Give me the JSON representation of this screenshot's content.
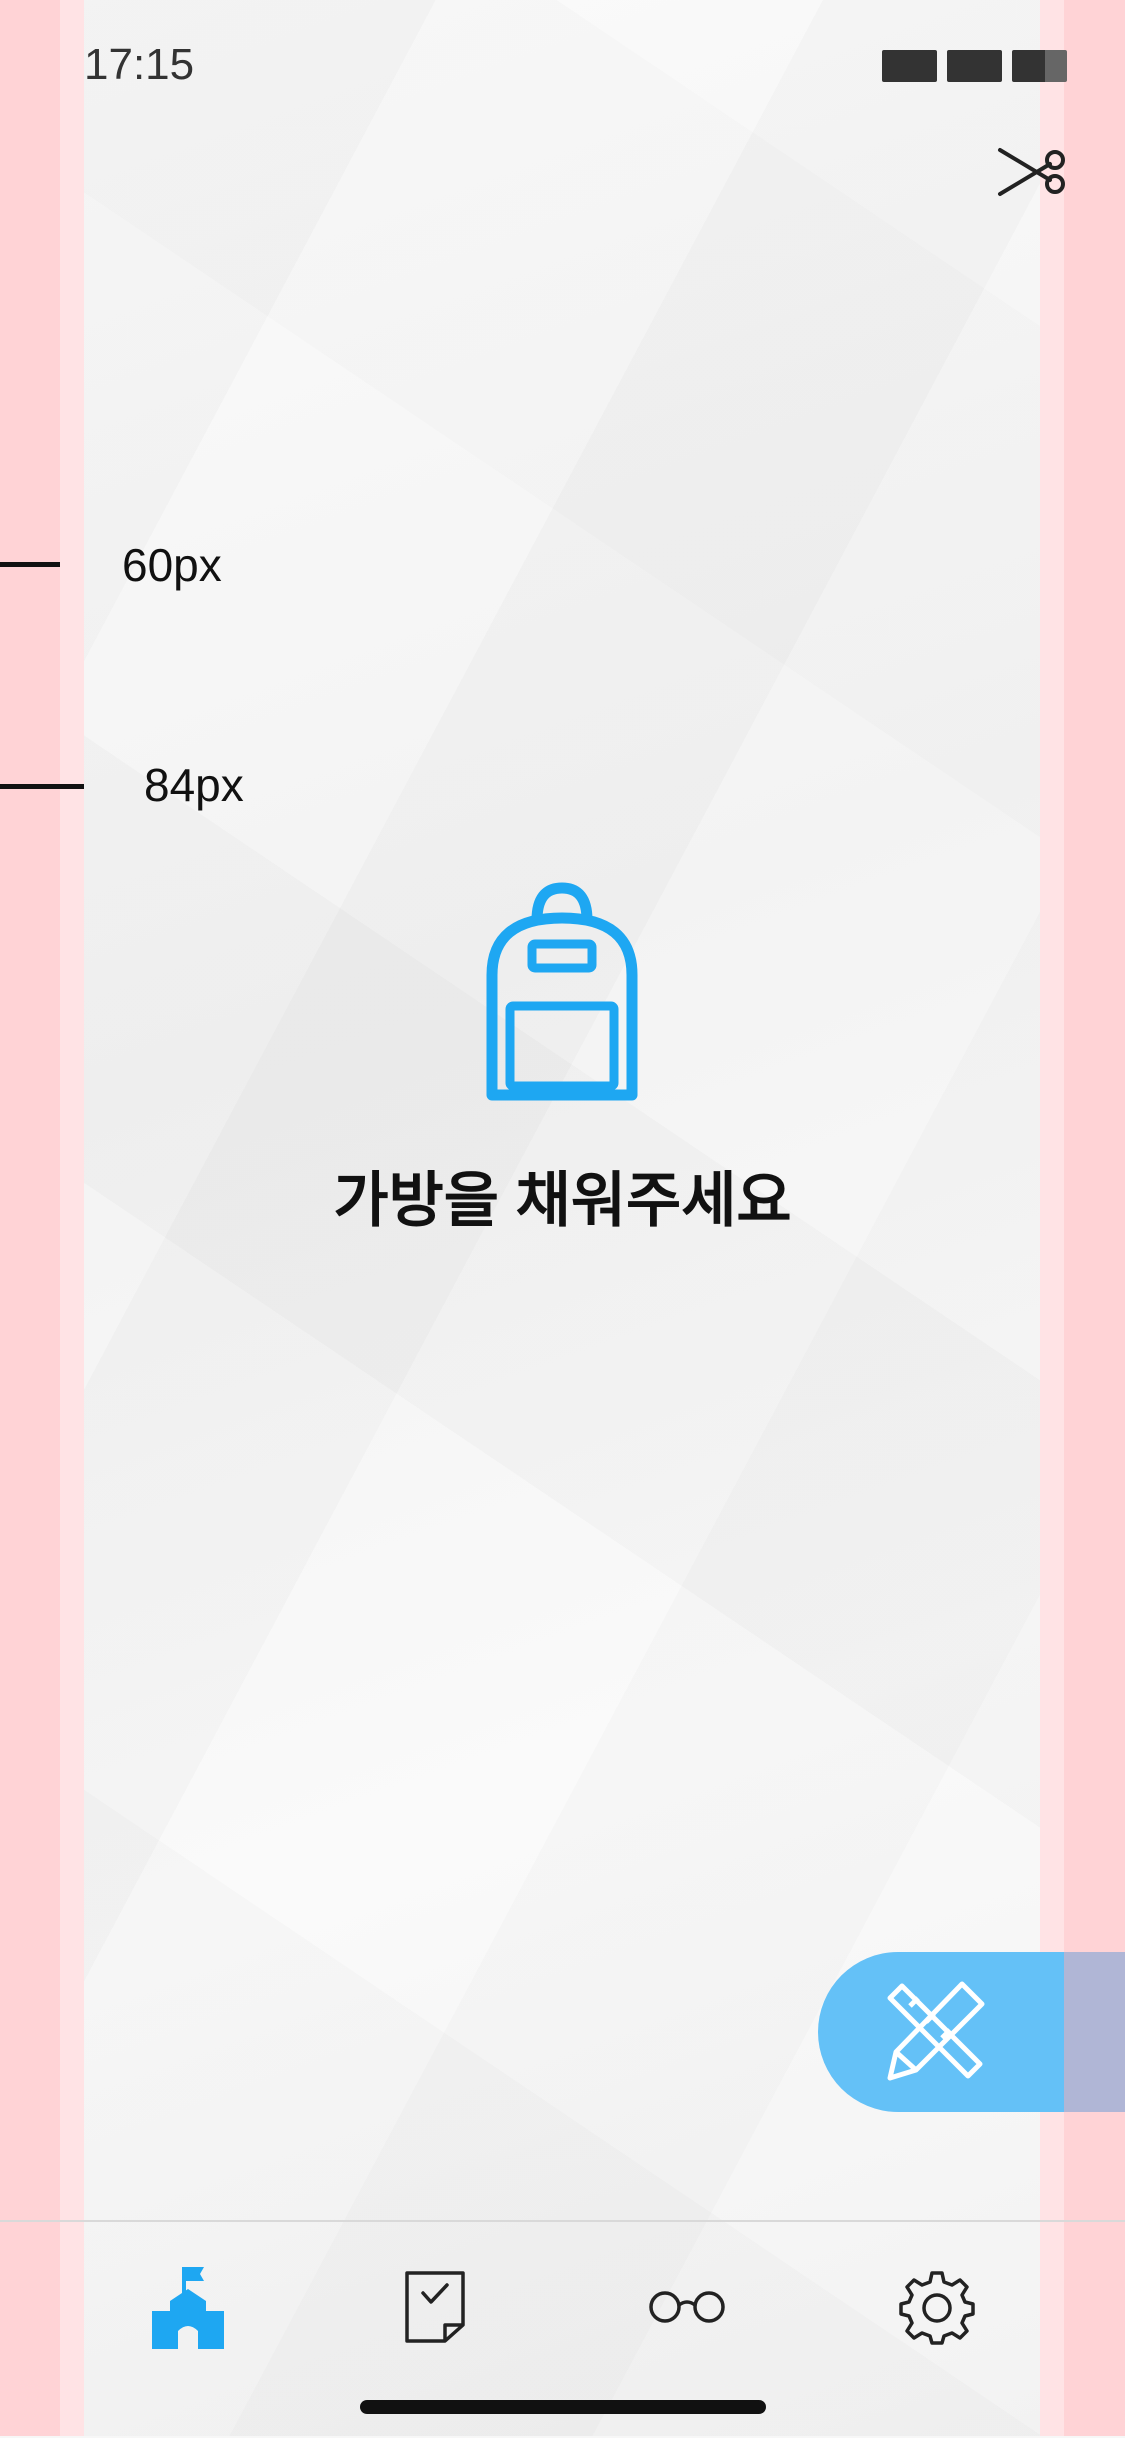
{
  "status_bar": {
    "time": "17:15"
  },
  "guides": {
    "label_60": "60px",
    "label_84": "84px"
  },
  "empty_state": {
    "icon": "backpack-icon",
    "message": "가방을 채워주세요"
  },
  "fab": {
    "icon": "pencil-ruler-icon"
  },
  "tab_bar": {
    "tabs": [
      {
        "icon": "school-icon",
        "active": true
      },
      {
        "icon": "note-check-icon",
        "active": false
      },
      {
        "icon": "glasses-icon",
        "active": false
      },
      {
        "icon": "gear-icon",
        "active": false
      }
    ]
  },
  "colors": {
    "accent": "#1ea7f2",
    "fab": "#64c1f7",
    "guide_band": "#ffd3d6",
    "text": "#111111"
  }
}
